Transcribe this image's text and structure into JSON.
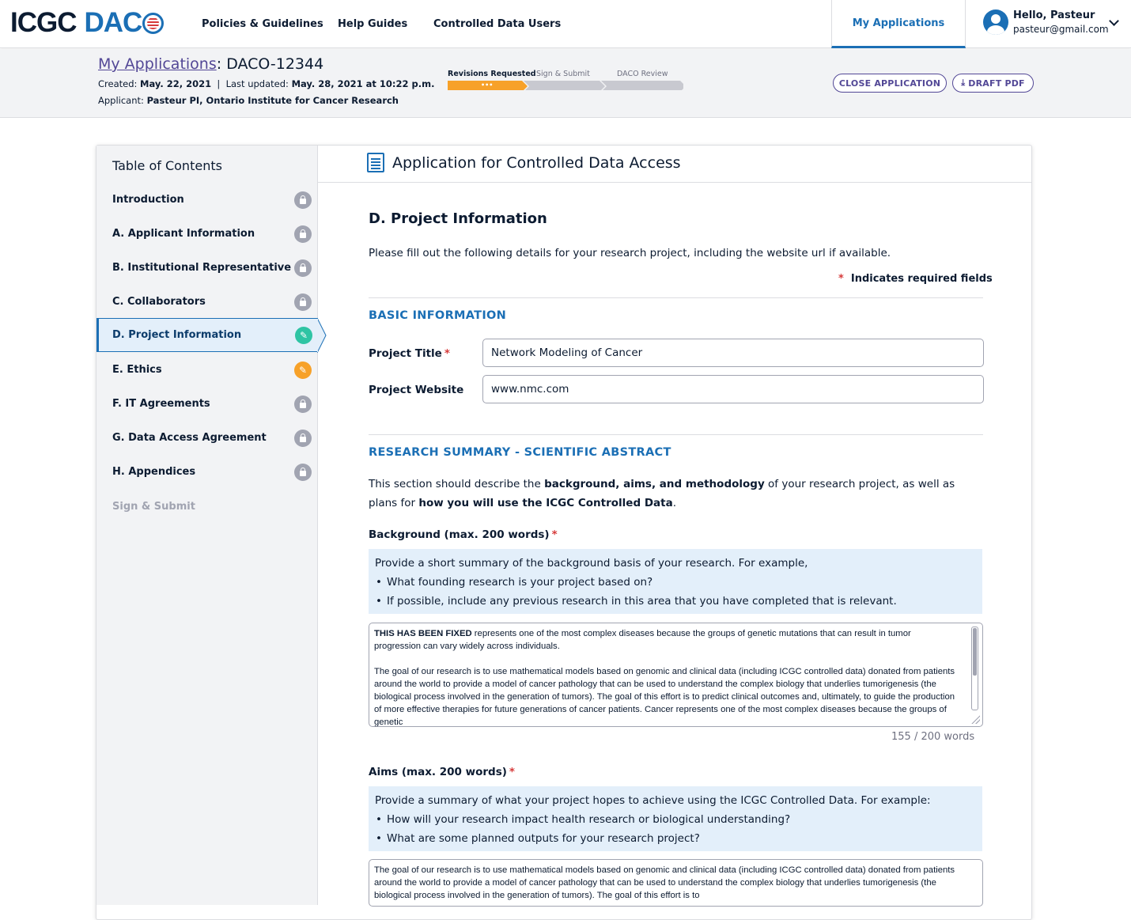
{
  "header": {
    "logo_icgc": "ICGC",
    "logo_daco": "DAC",
    "nav": [
      "Policies & Guidelines",
      "Help Guides",
      "Controlled Data Users"
    ],
    "active_tab": "My Applications",
    "user_greeting": "Hello, Pasteur",
    "user_email": "pasteur@gmail.com"
  },
  "subheader": {
    "breadcrumb_link": "My Applications",
    "app_id": ": DACO-12344",
    "created_label": "Created:",
    "created": "May. 22, 2021",
    "updated_label": "Last updated:",
    "updated": "May. 28, 2021 at 10:22 p.m.",
    "applicant_label": "Applicant:",
    "applicant": "Pasteur PI, Ontario Institute for Cancer Research",
    "steps": [
      "Revisions Requested",
      "Sign & Submit",
      "DACO Review"
    ],
    "step_current_dots": "•••",
    "close_button": "CLOSE APPLICATION",
    "pdf_button": "DRAFT PDF",
    "colors": {
      "progress_active": "#f7a129",
      "progress_inactive": "#c8c9d0",
      "accent": "#1b6fb5",
      "purple": "#524796"
    }
  },
  "toc": {
    "title": "Table of Contents",
    "items": [
      {
        "label": "Introduction",
        "status": "locked"
      },
      {
        "label": "A. Applicant Information",
        "status": "locked"
      },
      {
        "label": "B. Institutional Representative",
        "status": "locked"
      },
      {
        "label": "C. Collaborators",
        "status": "locked"
      },
      {
        "label": "D. Project Information",
        "status": "editing"
      },
      {
        "label": "E. Ethics",
        "status": "revisions"
      },
      {
        "label": "F. IT Agreements",
        "status": "locked"
      },
      {
        "label": "G. Data Access Agreement",
        "status": "locked"
      },
      {
        "label": "H. Appendices",
        "status": "locked"
      },
      {
        "label": "Sign & Submit",
        "status": "disabled"
      }
    ]
  },
  "main": {
    "form_title": "Application for Controlled Data Access",
    "section_title": "D. Project Information",
    "intro": "Please fill out the following details for your research project, including the website url if available.",
    "required_star": "*",
    "required_note": "Indicates required fields",
    "basic_heading": "BASIC INFORMATION",
    "project_title_label": "Project Title",
    "project_title_value": "Network Modeling of Cancer",
    "project_website_label": "Project Website",
    "project_website_value": "www.nmc.com",
    "summary_heading": "RESEARCH SUMMARY - SCIENTIFIC ABSTRACT",
    "summary_intro_1": "This section should describe the ",
    "summary_intro_bold1": "background, aims, and methodology",
    "summary_intro_2": " of your research project, as well as plans for ",
    "summary_intro_bold2": "how you will use the ICGC Controlled Data",
    "summary_intro_3": ".",
    "background_label": "Background (max. 200 words)",
    "background_hint": "Provide a short summary of the background basis of your research.  For example,",
    "background_hint_items": [
      "What founding research is your project based on?",
      "If possible, include any previous research in this area that you have completed that is relevant."
    ],
    "background_bold": "THIS HAS BEEN FIXED",
    "background_text_1": " represents one of the most complex diseases because the groups of genetic mutations that can result in tumor progression can vary widely across individuals.",
    "background_text_2": "The goal of our research is to use mathematical models based on genomic and clinical data (including ICGC controlled data) donated from patients around the world to provide a model of cancer pathology that can be used to understand the complex biology that underlies tumorigenesis (the biological process involved in the generation of tumors). The goal of this effort is to predict clinical outcomes and, ultimately, to guide the production of more effective therapies for future generations of cancer patients. Cancer represents one of the most complex diseases because the groups of genetic",
    "background_count": "155 / 200 words",
    "aims_label": "Aims (max. 200 words)",
    "aims_hint": "Provide a summary of what your project hopes to achieve using the ICGC Controlled Data. For example:",
    "aims_hint_items": [
      "How will your research impact health research or biological understanding?",
      "What are some planned outputs for your research project?"
    ],
    "aims_text": "The goal of our research is to use mathematical models based on genomic and clinical data (including ICGC controlled data) donated from patients around the world to provide a model of cancer pathology that can be used to understand the complex biology that underlies tumorigenesis (the biological process involved in the generation of tumors). The goal of this effort is to"
  }
}
